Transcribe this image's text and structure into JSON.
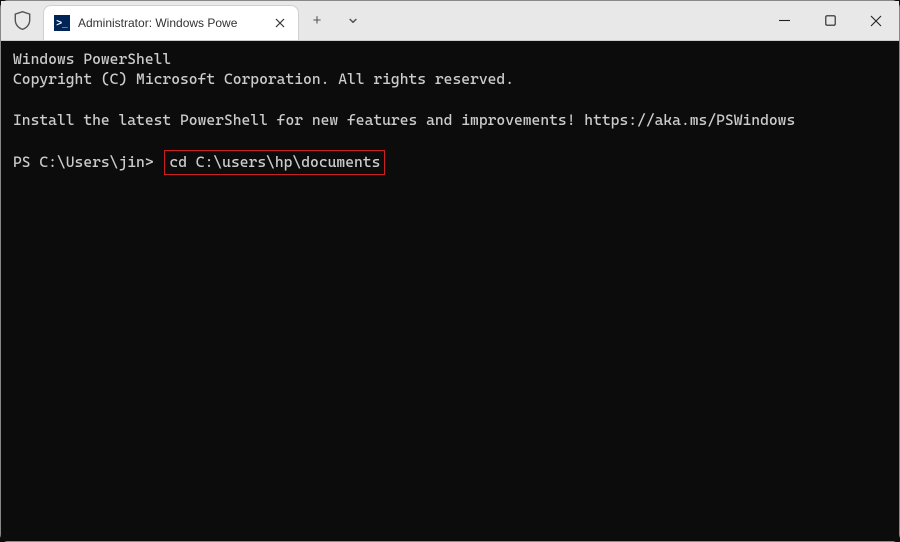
{
  "titlebar": {
    "tab": {
      "icon_glyph": ">_",
      "title": "Administrator: Windows Powe"
    },
    "new_tab_glyph": "+",
    "dropdown_glyph": "⌄"
  },
  "terminal": {
    "line1": "Windows PowerShell",
    "line2": "Copyright (C) Microsoft Corporation. All rights reserved.",
    "line3": "Install the latest PowerShell for new features and improvements! https://aka.ms/PSWindows",
    "prompt_prefix": "PS C:\\Users\\jin> ",
    "command": "cd C:\\users\\hp\\documents"
  }
}
